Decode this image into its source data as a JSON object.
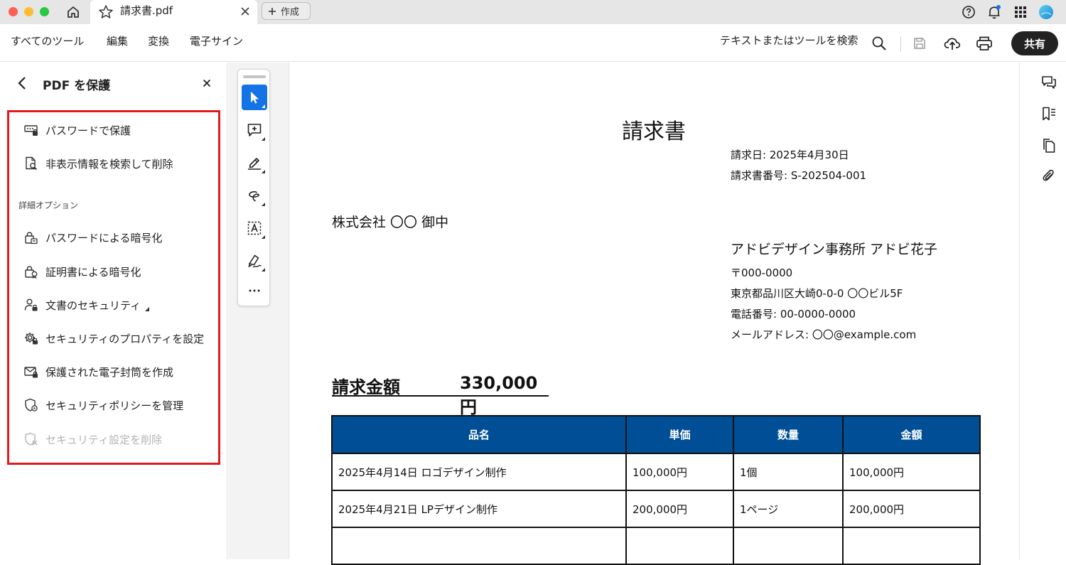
{
  "titlebar": {
    "tab_title": "請求書.pdf",
    "new_tab_label": "作成",
    "icons": [
      "home-icon",
      "star-icon",
      "close-icon",
      "help-icon",
      "bell-icon",
      "apps-grid-icon",
      "avatar"
    ],
    "colors": {
      "notification_dot": "#1473e6"
    }
  },
  "menubar": {
    "items": [
      "すべてのツール",
      "編集",
      "変換",
      "電子サイン"
    ],
    "search_label": "テキストまたはツールを検索",
    "share_label": "共有"
  },
  "panel": {
    "title": "PDF を保護",
    "options_top": [
      {
        "label": "パスワードで保護",
        "icon": "password-field-lock-icon"
      },
      {
        "label": "非表示情報を検索して削除",
        "icon": "document-search-icon"
      }
    ],
    "section_label": "詳細オプション",
    "options_advanced": [
      {
        "label": "パスワードによる暗号化",
        "icon": "lock-document-icon"
      },
      {
        "label": "証明書による暗号化",
        "icon": "certificate-lock-icon"
      },
      {
        "label": "文書のセキュリティ",
        "icon": "user-lock-icon"
      },
      {
        "label": "セキュリティのプロパティを設定",
        "icon": "gear-lock-icon"
      },
      {
        "label": "保護された電子封筒を作成",
        "icon": "envelope-lock-icon"
      },
      {
        "label": "セキュリティポリシーを管理",
        "icon": "shield-gear-icon"
      },
      {
        "label": "セキュリティ設定を削除",
        "icon": "shield-x-icon"
      }
    ],
    "colors": {
      "highlight_box": "#e11b1b",
      "disabled_text": "#b3b3b3"
    }
  },
  "toolbar": {
    "tools": [
      "select-arrow-icon",
      "add-comment-icon",
      "highlight-pen-icon",
      "freehand-draw-icon",
      "text-box-icon",
      "sign-pen-icon",
      "more-icon"
    ],
    "colors": {
      "active": "#1473e6"
    }
  },
  "document": {
    "title": "請求書",
    "invoice_date": "請求日: 2025年4月30日",
    "invoice_number": "請求書番号: S-202504-001",
    "recipient": "株式会社 〇〇 御中",
    "sender_name": "アドビデザイン事務所 アドビ花子",
    "postal": "〒000-0000",
    "address": "東京都品川区大崎0-0-0 〇〇ビル5F",
    "phone": "電話番号: 00-0000-0000",
    "email": "メールアドレス: 〇〇@example.com",
    "amount_label": "請求金額",
    "amount_value": "330,000円",
    "table": {
      "headers": [
        "品名",
        "単価",
        "数量",
        "金額"
      ],
      "rows": [
        [
          "2025年4月14日 ロゴデザイン制作",
          "100,000円",
          "1個",
          "100,000円"
        ],
        [
          "2025年4月21日 LPデザイン制作",
          "200,000円",
          "1ページ",
          "200,000円"
        ],
        [
          "",
          "",
          "",
          ""
        ]
      ],
      "colors": {
        "header_bg": "#004f96"
      }
    }
  },
  "rightrail": {
    "icons": [
      "comments-icon",
      "bookmarks-icon",
      "pages-icon",
      "attachment-icon"
    ]
  }
}
